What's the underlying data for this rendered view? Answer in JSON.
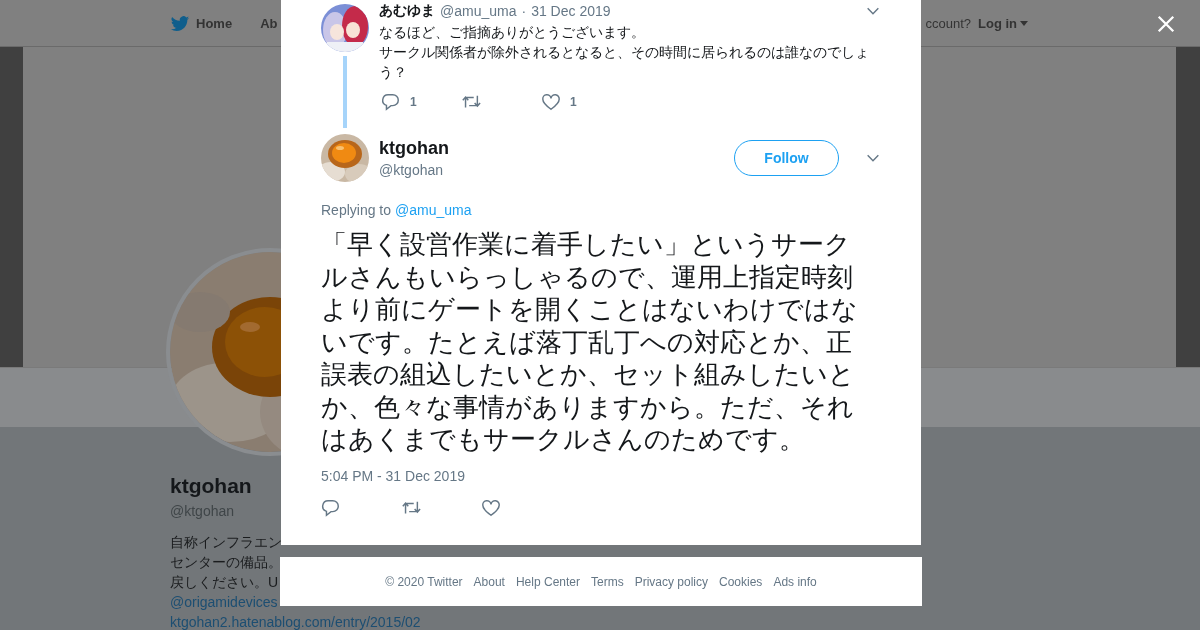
{
  "background_page": {
    "nav": {
      "items": [
        {
          "label": "Home",
          "kind": "bird"
        },
        {
          "label": "Ab",
          "kind": "plain"
        }
      ],
      "account_prompt": "ccount?",
      "login": "Log in"
    },
    "profile": {
      "name": "ktgohan",
      "handle": "@ktgohan",
      "bio_lines": [
        "自称インフラエン",
        "センターの備品。",
        "戻しください。U"
      ],
      "links": [
        "@origamidevices",
        "ktgohan2.hatenablog.com/entry/2015/02"
      ]
    }
  },
  "modal": {
    "parent_tweet": {
      "name": "あむゆま",
      "handle": "@amu_uma",
      "separator": "·",
      "date": "31 Dec 2019",
      "text": [
        "なるほど、ご指摘ありがとうございます。",
        "サークル関係者が除外されるとなると、その時間に居られるのは誰なのでしょう？"
      ],
      "replies": "1",
      "likes": "1"
    },
    "tweet": {
      "name": "ktgohan",
      "handle": "@ktgohan",
      "follow": "Follow",
      "replying_prefix": "Replying to",
      "replying_to": "@amu_uma",
      "text": "「早く設営作業に着手したい」というサークルさんもいらっしゃるので、運用上指定時刻より前にゲートを開くことはないわけではないです。たとえば落丁乱丁への対応とか、正誤表の組込したいとか、セット組みしたいとか、色々な事情がありますから。ただ、それはあくまでもサークルさんのためです。",
      "timestamp": "5:04 PM - 31 Dec 2019"
    }
  },
  "footer": {
    "links": [
      "© 2020 Twitter",
      "About",
      "Help Center",
      "Terms",
      "Privacy policy",
      "Cookies",
      "Ads info"
    ]
  }
}
